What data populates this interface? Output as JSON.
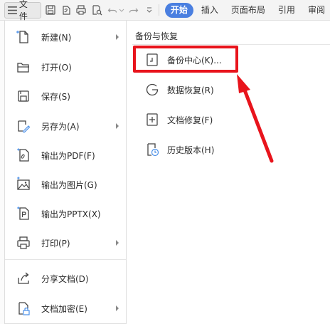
{
  "toolbar": {
    "file_label": "文件",
    "icons": [
      "save-icon",
      "export-pdf-icon",
      "print-icon",
      "print-preview-icon",
      "undo-icon",
      "redo-icon",
      "customize-icon"
    ],
    "tabs": [
      {
        "label": "开始",
        "active": true
      },
      {
        "label": "插入",
        "active": false
      },
      {
        "label": "页面布局",
        "active": false
      },
      {
        "label": "引用",
        "active": false
      },
      {
        "label": "审阅",
        "active": false
      }
    ],
    "accent_color": "#4a7fe0"
  },
  "menu": {
    "items": [
      {
        "label": "新建(N)",
        "icon": "new-file-icon",
        "has_submenu": true
      },
      {
        "label": "打开(O)",
        "icon": "open-folder-icon",
        "has_submenu": false
      },
      {
        "label": "保存(S)",
        "icon": "save-icon",
        "has_submenu": false
      },
      {
        "label": "另存为(A)",
        "icon": "save-as-icon",
        "has_submenu": true
      },
      {
        "label": "输出为PDF(F)",
        "icon": "export-pdf-icon",
        "has_submenu": false
      },
      {
        "label": "输出为图片(G)",
        "icon": "export-image-icon",
        "has_submenu": false
      },
      {
        "label": "输出为PPTX(X)",
        "icon": "export-pptx-icon",
        "has_submenu": false
      },
      {
        "label": "打印(P)",
        "icon": "print-icon",
        "has_submenu": true
      },
      {
        "label": "分享文档(D)",
        "icon": "share-icon",
        "has_submenu": false
      },
      {
        "label": "文档加密(E)",
        "icon": "encrypt-icon",
        "has_submenu": true
      }
    ]
  },
  "submenu": {
    "title": "备份与恢复",
    "items": [
      {
        "label": "备份中心(K)...",
        "icon": "backup-center-icon"
      },
      {
        "label": "数据恢复(R)",
        "icon": "data-recovery-icon"
      },
      {
        "label": "文档修复(F)",
        "icon": "document-repair-icon"
      },
      {
        "label": "历史版本(H)",
        "icon": "history-version-icon"
      }
    ]
  },
  "annotation": {
    "highlight_color": "#e8141c"
  }
}
